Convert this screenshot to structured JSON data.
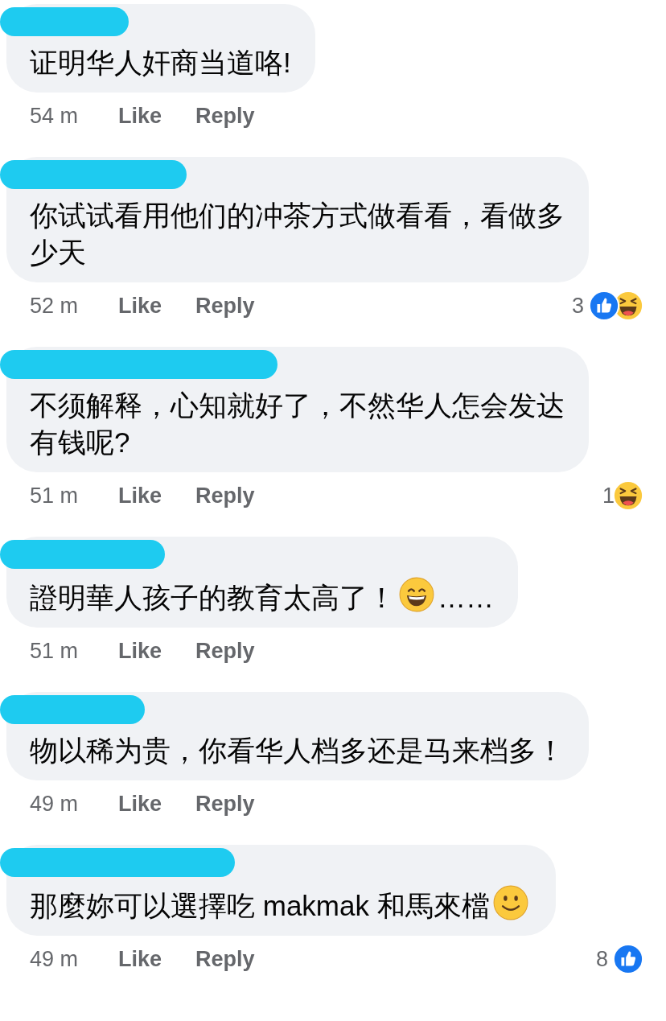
{
  "comments": [
    {
      "lines": [
        [
          {
            "kind": "text",
            "text": "证明华人奸商当道咯!"
          }
        ]
      ],
      "time": "54 m",
      "like": "Like",
      "reply": "Reply"
    },
    {
      "lines": [
        [
          {
            "kind": "text",
            "text": "你试试看用他们的冲茶方式做看看，看做多"
          }
        ],
        [
          {
            "kind": "text",
            "text": "少天"
          }
        ]
      ],
      "time": "52 m",
      "like": "Like",
      "reply": "Reply",
      "reaction_count": "3",
      "reactions": [
        {
          "kind": "like"
        },
        {
          "kind": "haha"
        }
      ]
    },
    {
      "lines": [
        [
          {
            "kind": "text",
            "text": "不须解释，心知就好了，不然华人怎会发达"
          }
        ],
        [
          {
            "kind": "text",
            "text": "有钱呢?"
          }
        ]
      ],
      "time": "51 m",
      "like": "Like",
      "reply": "Reply",
      "reaction_count": "1",
      "reactions": [
        {
          "kind": "haha"
        }
      ]
    },
    {
      "lines": [
        [
          {
            "kind": "text",
            "text": "證明華人孩子的教育太高了！"
          },
          {
            "kind": "grin"
          },
          {
            "kind": "text",
            "text": "……"
          }
        ]
      ],
      "time": "51 m",
      "like": "Like",
      "reply": "Reply"
    },
    {
      "lines": [
        [
          {
            "kind": "text",
            "text": "物以稀为贵，你看华人档多还是马来档多！"
          }
        ]
      ],
      "time": "49 m",
      "like": "Like",
      "reply": "Reply"
    },
    {
      "lines": [
        [
          {
            "kind": "text",
            "text": "那麼妳可以選擇吃 makmak 和馬來檔"
          },
          {
            "kind": "smile"
          }
        ]
      ],
      "time": "49 m",
      "like": "Like",
      "reply": "Reply",
      "reaction_count": "8",
      "reactions": [
        {
          "kind": "like"
        }
      ]
    }
  ]
}
